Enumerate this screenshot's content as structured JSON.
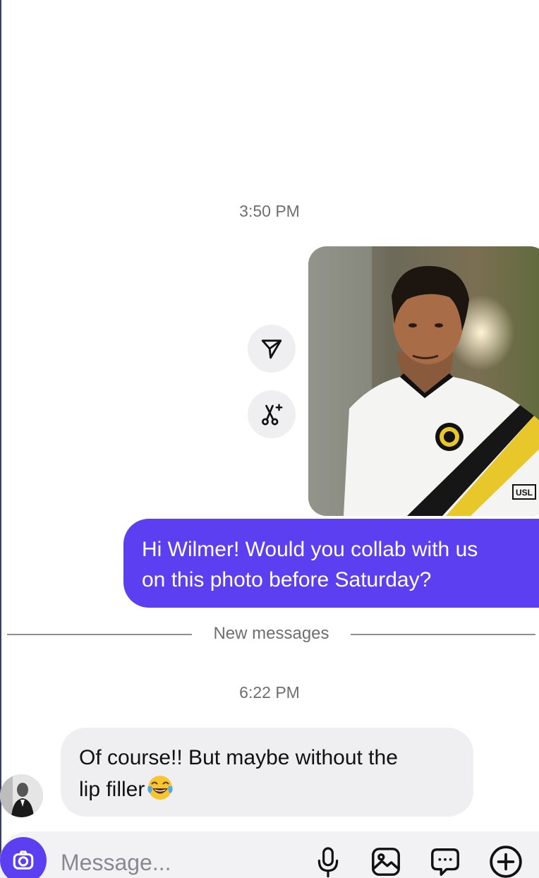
{
  "conversation": {
    "timestamp_1": "3:50 PM",
    "timestamp_2": "6:22 PM",
    "new_messages_label": "New messages"
  },
  "outgoing_message": {
    "line1": "Hi Wilmer! Would you collab with us",
    "line2": "on this photo before Saturday?",
    "bubble_color": "#5b3ff0"
  },
  "photo_message": {
    "jersey_badge": "USL"
  },
  "incoming_message": {
    "line1": "Of course!! But maybe without the",
    "line2": "lip filler",
    "emoji": "face-with-tears-of-joy"
  },
  "composer": {
    "placeholder": "Message...",
    "accent_color": "#5b3ff0"
  },
  "icons": {
    "share": "paper-plane-icon",
    "remix": "remix-scissors-icon",
    "camera": "camera-icon",
    "mic": "microphone-icon",
    "gallery": "image-icon",
    "sticker": "message-bubble-icon",
    "add": "plus-circle-icon"
  }
}
